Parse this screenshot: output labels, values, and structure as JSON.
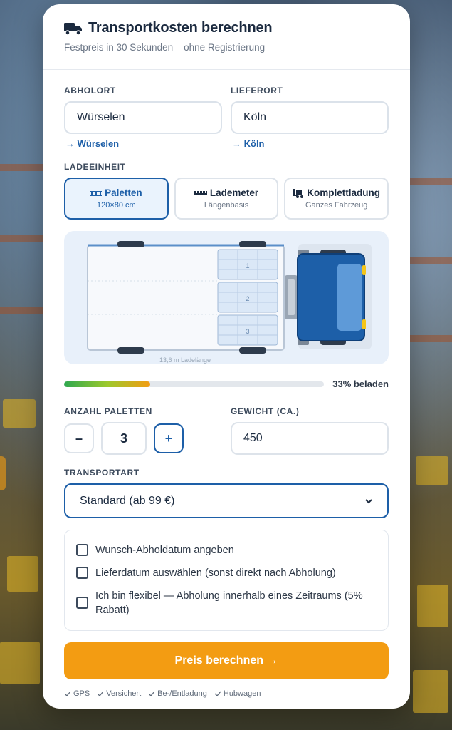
{
  "header": {
    "title": "Transportkosten berechnen",
    "subtitle": "Festpreis in 30 Sekunden – ohne Registrierung"
  },
  "pickup": {
    "label": "ABHOLORT",
    "value": "Würselen",
    "suggestion": "→ Würselen"
  },
  "delivery": {
    "label": "LIEFERORT",
    "value": "Köln",
    "suggestion": "→ Köln"
  },
  "load_unit": {
    "label": "LADEEINHEIT",
    "options": [
      {
        "title": "Paletten",
        "sub": "120×80 cm",
        "selected": true
      },
      {
        "title": "Lademeter",
        "sub": "Längenbasis",
        "selected": false
      },
      {
        "title": "Komplettladung",
        "sub": "Ganzes Fahrzeug",
        "selected": false
      }
    ]
  },
  "truck": {
    "pallets": [
      "1",
      "2",
      "3"
    ],
    "length_caption": "13,6 m Ladelänge"
  },
  "load": {
    "fraction": 0.33,
    "text": "33% beladen"
  },
  "quantity": {
    "label": "ANZAHL PALETTEN",
    "value": "3",
    "minus": "–",
    "plus": "+"
  },
  "weight": {
    "label": "GEWICHT (CA.)",
    "value": "450"
  },
  "transport_type": {
    "label": "TRANSPORTART",
    "selected": "Standard (ab 99 €)"
  },
  "options": [
    "Wunsch-Abholdatum angeben",
    "Lieferdatum auswählen (sonst direkt nach Abholung)",
    "Ich bin flexibel — Abholung innerhalb eines Zeitraums (5% Rabatt)"
  ],
  "cta": {
    "label": "Preis berechnen →"
  },
  "trust": [
    "GPS",
    "Versichert",
    "Be-/Entladung",
    "Hubwagen"
  ],
  "colors": {
    "primary": "#1d5fa8",
    "accent": "#f39c12",
    "text": "#1b2a3f"
  }
}
